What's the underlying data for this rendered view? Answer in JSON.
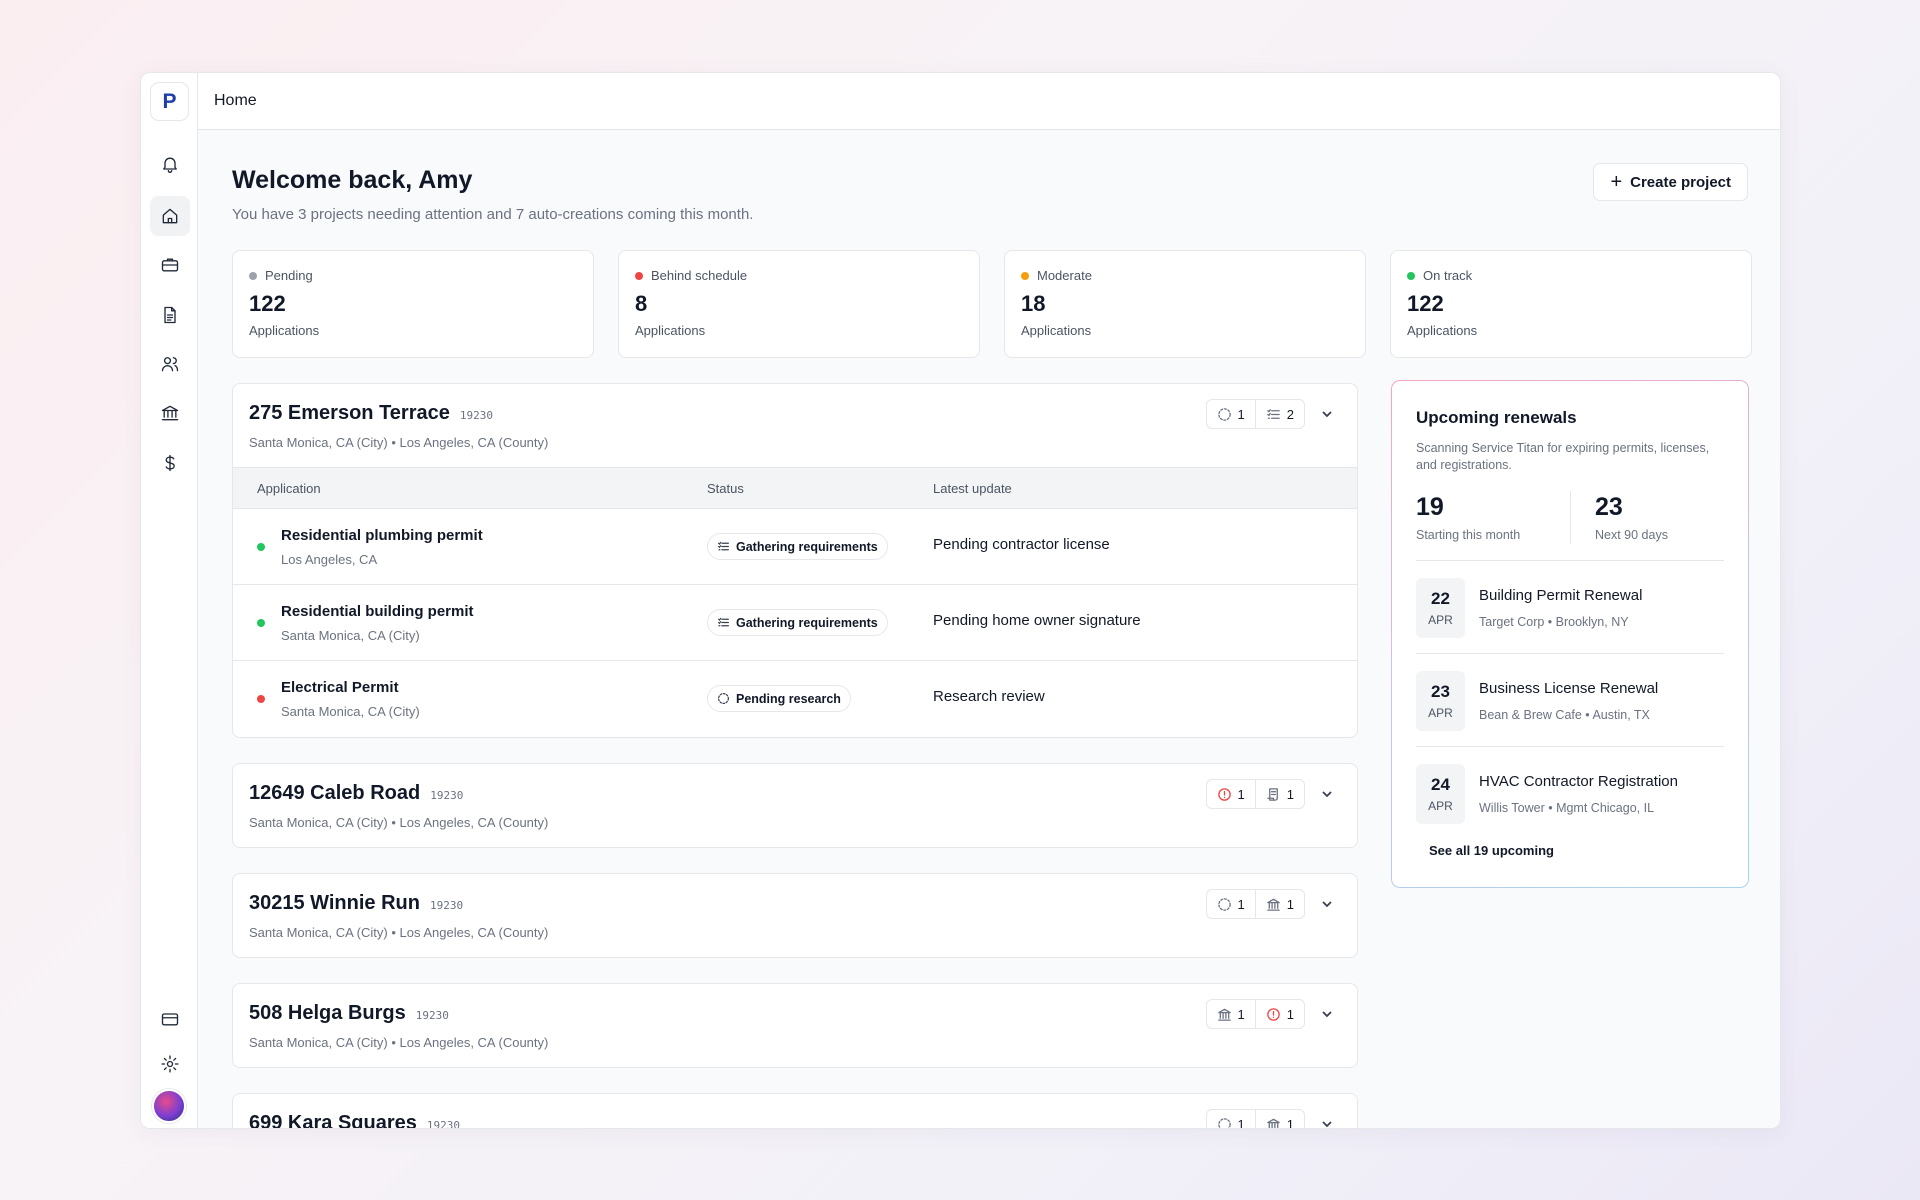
{
  "logo": "P",
  "topbar": {
    "breadcrumb": "Home"
  },
  "header": {
    "welcome": "Welcome back, Amy",
    "subtitle": "You have 3 projects needing attention and 7 auto-creations coming this month.",
    "create_label": "Create project"
  },
  "stats": [
    {
      "label": "Pending",
      "value": "122",
      "sub": "Applications",
      "color": "#9ca3af"
    },
    {
      "label": "Behind schedule",
      "value": "8",
      "sub": "Applications",
      "color": "#ef4444"
    },
    {
      "label": "Moderate",
      "value": "18",
      "sub": "Applications",
      "color": "#f59e0b"
    },
    {
      "label": "On track",
      "value": "122",
      "sub": "Applications",
      "color": "#22c55e"
    }
  ],
  "table_headers": {
    "application": "Application",
    "status": "Status",
    "latest_update": "Latest update"
  },
  "projects": [
    {
      "name": "275 Emerson Terrace",
      "code": "19230",
      "location": "Santa Monica, CA (City) • Los Angeles, CA (County)",
      "badges": [
        {
          "icon": "pending-circle-icon",
          "count": "1"
        },
        {
          "icon": "checklist-icon",
          "count": "2"
        }
      ],
      "rows": [
        {
          "name": "Residential plumbing permit",
          "location": "Los Angeles, CA",
          "dot": "#22c55e",
          "status": "Gathering requirements",
          "status_icon": "checklist-icon",
          "update": "Pending contractor license"
        },
        {
          "name": "Residential building permit",
          "location": "Santa Monica, CA (City)",
          "dot": "#22c55e",
          "status": "Gathering requirements",
          "status_icon": "checklist-icon",
          "update": "Pending home owner signature"
        },
        {
          "name": "Electrical Permit",
          "location": "Santa Monica, CA (City)",
          "dot": "#ef4444",
          "status": "Pending research",
          "status_icon": "pending-circle-icon",
          "update": "Research review"
        }
      ]
    },
    {
      "name": "12649 Caleb Road",
      "code": "19230",
      "location": "Santa Monica, CA (City) • Los Angeles, CA (County)",
      "badges": [
        {
          "icon": "alert-circle-icon",
          "count": "1"
        },
        {
          "icon": "scroll-icon",
          "count": "1"
        }
      ]
    },
    {
      "name": "30215 Winnie Run",
      "code": "19230",
      "location": "Santa Monica, CA (City) • Los Angeles, CA (County)",
      "badges": [
        {
          "icon": "pending-circle-icon",
          "count": "1"
        },
        {
          "icon": "bank-icon",
          "count": "1"
        }
      ]
    },
    {
      "name": "508 Helga Burgs",
      "code": "19230",
      "location": "Santa Monica, CA (City) • Los Angeles, CA (County)",
      "badges": [
        {
          "icon": "bank-icon",
          "count": "1"
        },
        {
          "icon": "alert-circle-icon",
          "count": "1"
        }
      ]
    },
    {
      "name": "699 Kara Squares",
      "code": "19230",
      "location": "",
      "badges": [
        {
          "icon": "pending-circle-icon",
          "count": "1"
        },
        {
          "icon": "bank-icon",
          "count": "1"
        }
      ]
    }
  ],
  "renewals": {
    "title": "Upcoming renewals",
    "description": "Scanning Service Titan for expiring permits, licenses, and registrations.",
    "stat1": {
      "value": "19",
      "label": "Starting this month"
    },
    "stat2": {
      "value": "23",
      "label": "Next 90 days"
    },
    "items": [
      {
        "day": "22",
        "month": "APR",
        "title": "Building Permit Renewal",
        "sub": "Target Corp • Brooklyn, NY"
      },
      {
        "day": "23",
        "month": "APR",
        "title": "Business License Renewal",
        "sub": "Bean & Brew Cafe • Austin, TX"
      },
      {
        "day": "24",
        "month": "APR",
        "title": "HVAC Contractor Registration",
        "sub": "Willis Tower • Mgmt Chicago, IL"
      }
    ],
    "see_all": "See all 19 upcoming"
  },
  "colors": {
    "accent": "#1f3ea8",
    "red": "#ef4444",
    "green": "#22c55e",
    "amber": "#f59e0b",
    "gray": "#9ca3af"
  }
}
